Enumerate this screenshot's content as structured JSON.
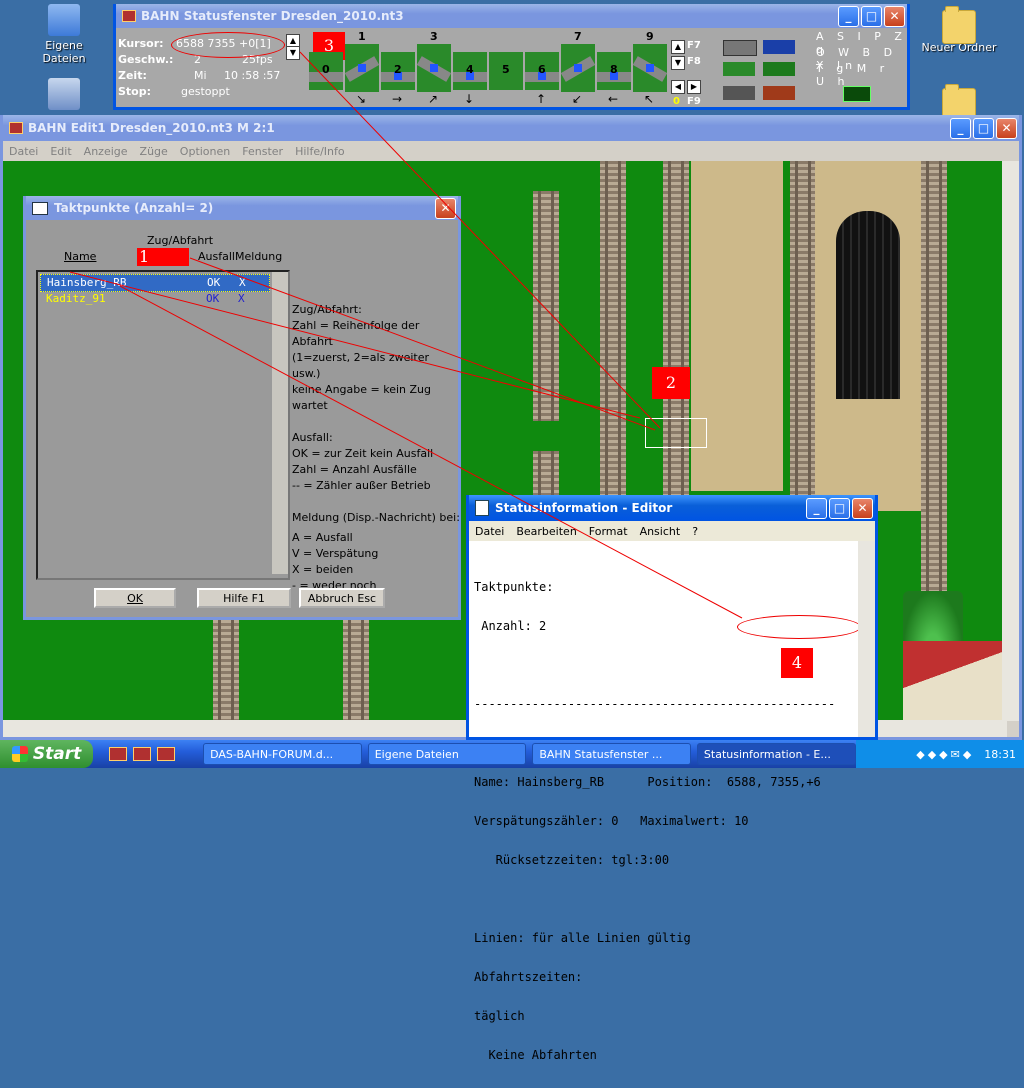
{
  "desktop": {
    "icons": [
      {
        "label": "Eigene Dateien"
      },
      {
        "label": "Neuer Ordner"
      }
    ]
  },
  "status_window": {
    "title": "BAHN Statusfenster Dresden_2010.nt3",
    "labels": {
      "cursor": "Kursor:",
      "speed": "Geschw.:",
      "time": "Zeit:",
      "stop": "Stop:"
    },
    "values": {
      "cursor": "6588  7355 +0[1]",
      "speed": "2",
      "fps": "25fps",
      "day": "Mi",
      "clock": "10 :58 :57",
      "stop": "gestoppt"
    },
    "track_numbers": [
      "0",
      "1",
      "2",
      "3",
      "4",
      "5",
      "6",
      "7",
      "8",
      "9"
    ],
    "direction_arrows": [
      "↘",
      "→",
      "↗",
      "↓",
      "",
      "↑",
      "↙",
      "←",
      "↖"
    ],
    "fkeys": [
      "F7",
      "F8",
      "F9"
    ],
    "zero_marker": "0",
    "letters_row1": "A S I P Z q",
    "letters_row2": "O W B D X ln",
    "letters_row3": "T g M r U h"
  },
  "edit_window": {
    "title": "BAHN Edit1 Dresden_2010.nt3 M 2:1",
    "menu": [
      "Datei",
      "Edit",
      "Anzeige",
      "Züge",
      "Optionen",
      "Fenster",
      "Hilfe/Info"
    ]
  },
  "takt_dialog": {
    "title": "Taktpunkte (Anzahl= 2)",
    "headers": {
      "name": "Name",
      "zug": "Zug/Abfahrt",
      "ausfall": "Ausfall",
      "meldung": "Meldung"
    },
    "rows": [
      {
        "name": "Hainsberg_RB",
        "ausfall": "OK",
        "meldung": "X"
      },
      {
        "name": "Kaditz_91",
        "ausfall": "OK",
        "meldung": "X"
      }
    ],
    "help_lines": [
      "Zug/Abfahrt:",
      "Zahl = Reihenfolge der Abfahrt",
      "(1=zuerst, 2=als zweiter usw.)",
      "keine Angabe = kein Zug wartet",
      "",
      "Ausfall:",
      "OK = zur Zeit kein Ausfall",
      "Zahl = Anzahl Ausfälle",
      "-- = Zähler außer Betrieb",
      "",
      "Meldung (Disp.-Nachricht) bei:",
      "",
      "A = Ausfall",
      "V = Verspätung",
      "X = beiden",
      "- = weder noch"
    ],
    "buttons": {
      "ok": "OK",
      "help": "Hilfe      F1",
      "cancel": "Abbruch   Esc"
    }
  },
  "annotations": {
    "m1": "1",
    "m2": "2",
    "m3": "3",
    "m4": "4"
  },
  "editor_window": {
    "title": "Statusinformation - Editor",
    "menu": [
      "Datei",
      "Bearbeiten",
      "Format",
      "Ansicht",
      "?"
    ],
    "lines": [
      "Taktpunkte:",
      " Anzahl: 2",
      "",
      "--------------------------------------------------",
      "",
      "Name: Hainsberg_RB      Position:  6588, 7355,+6",
      "Verspätungszähler: 0   Maximalwert: 10",
      "   Rücksetzzeiten: tgl:3:00",
      "",
      "Linien: für alle Linien gültig",
      "Abfahrtszeiten:",
      "täglich",
      "  Keine Abfahrten"
    ]
  },
  "taskbar": {
    "start": "Start",
    "tasks": [
      "DAS-BAHN-FORUM.d...",
      "Eigene Dateien",
      "BAHN Statusfenster ...",
      "Statusinformation - E..."
    ],
    "clock": "18:31"
  },
  "colors": {
    "xp_blue": "#0054e3",
    "annotation_red": "#ff0000",
    "taskbar_blue": "#245edb",
    "green_ground": "#0f8a0f"
  }
}
